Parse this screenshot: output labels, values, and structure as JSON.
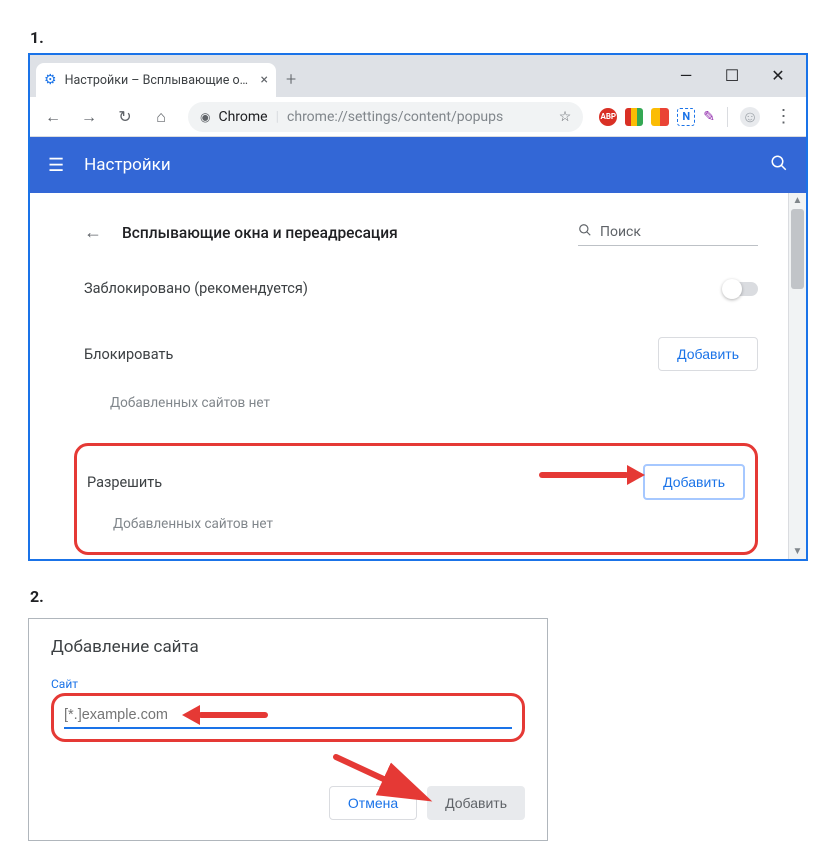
{
  "step1_label": "1.",
  "step2_label": "2.",
  "tab": {
    "title": "Настройки – Всплывающие окн",
    "close": "×",
    "new_tab": "+"
  },
  "win": {
    "min": "—",
    "max": "☐",
    "close": "✕"
  },
  "omni": {
    "chrome_label": "Chrome",
    "url": "chrome://settings/content/popups"
  },
  "appbar": {
    "title": "Настройки"
  },
  "section": {
    "title": "Всплывающие окна и переадресация",
    "search_placeholder": "Поиск"
  },
  "blocked_row": "Заблокировано (рекомендуется)",
  "block_section": {
    "label": "Блокировать",
    "add": "Добавить",
    "empty": "Добавленных сайтов нет"
  },
  "allow_section": {
    "label": "Разрешить",
    "add": "Добавить",
    "empty": "Добавленных сайтов нет"
  },
  "dialog": {
    "title": "Добавление сайта",
    "field_label": "Сайт",
    "placeholder": "[*.]example.com",
    "cancel": "Отмена",
    "add": "Добавить"
  }
}
